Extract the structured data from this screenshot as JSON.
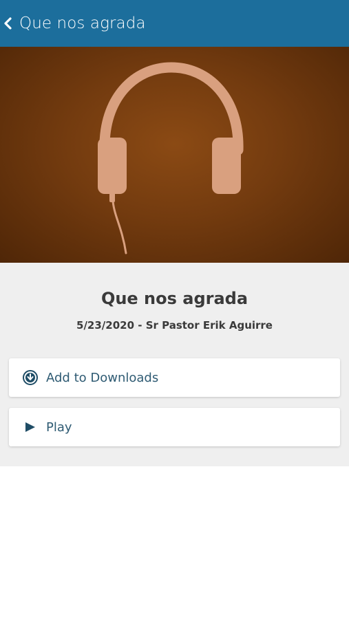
{
  "header": {
    "back_icon": "chevron-left-icon",
    "title": "Que nos agrada"
  },
  "artwork": {
    "icon": "headphones-icon",
    "background_color": "#733b0f",
    "icon_color": "#d9a07f"
  },
  "episode": {
    "title": "Que nos agrada",
    "meta": "5/23/2020 - Sr Pastor Erik Aguirre"
  },
  "actions": [
    {
      "label": "Add to Downloads",
      "icon": "download-circle-icon"
    },
    {
      "label": "Play",
      "icon": "play-icon"
    }
  ],
  "colors": {
    "header_bg": "#1c6e9c",
    "accent": "#1f4d66",
    "info_bg": "#efefef"
  }
}
